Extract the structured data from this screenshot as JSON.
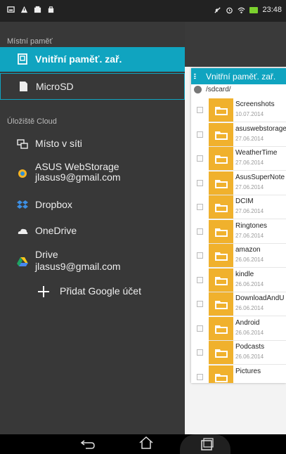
{
  "status_bar": {
    "time": "23:48",
    "left_icons": [
      "image-icon",
      "warning-icon",
      "download-icon",
      "shopping-bag-icon"
    ],
    "right_icons": [
      "mute-icon",
      "alarm-icon",
      "wifi-icon",
      "battery-charging-icon"
    ]
  },
  "drawer": {
    "local_section_label": "Místní paměť",
    "local_items": [
      {
        "label": "Vnitřní paměť. zař.",
        "icon": "phone-storage-icon"
      },
      {
        "label": "MicroSD",
        "icon": "sd-card-icon"
      }
    ],
    "cloud_section_label": "Úložiště Cloud",
    "cloud_items": [
      {
        "label": "Místo v síti",
        "icon": "network-icon"
      },
      {
        "service": "ASUS WebStorage",
        "label": "jlasus9@gmail.com",
        "icon": "asus-webstorage-icon"
      },
      {
        "label": "Dropbox",
        "icon": "dropbox-icon"
      },
      {
        "label": "OneDrive",
        "icon": "onedrive-icon"
      },
      {
        "service": "Drive",
        "label": "jlasus9@gmail.com",
        "icon": "google-drive-icon"
      }
    ],
    "add_account_label": "Přidat Google účet"
  },
  "file_panel": {
    "title": "Vnitřní paměť. zař.",
    "path": "/sdcard/",
    "files": [
      {
        "name": "Screenshots",
        "date": "10.07.2014"
      },
      {
        "name": "asuswebstorage",
        "date": "27.06.2014"
      },
      {
        "name": "WeatherTime",
        "date": "27.06.2014"
      },
      {
        "name": "AsusSuperNote",
        "date": "27.06.2014"
      },
      {
        "name": "DCIM",
        "date": "27.06.2014"
      },
      {
        "name": "Ringtones",
        "date": "27.06.2014"
      },
      {
        "name": "amazon",
        "date": "26.06.2014"
      },
      {
        "name": "kindle",
        "date": "26.06.2014"
      },
      {
        "name": "DownloadAndU",
        "date": "26.06.2014"
      },
      {
        "name": "Android",
        "date": "26.06.2014"
      },
      {
        "name": "Podcasts",
        "date": "26.06.2014"
      },
      {
        "name": "Pictures",
        "date": ""
      }
    ]
  },
  "colors": {
    "accent": "#10a4c0",
    "folder": "#f0b12d",
    "drawer_bg": "#383838"
  }
}
